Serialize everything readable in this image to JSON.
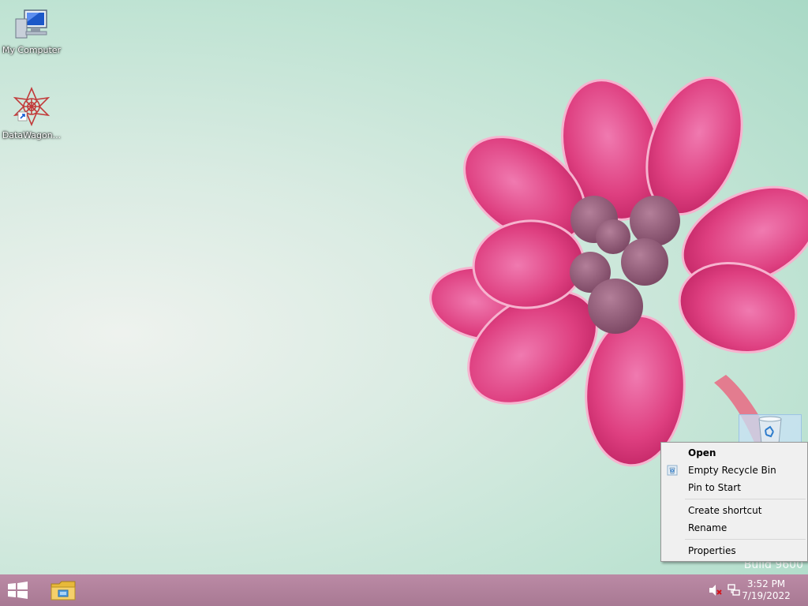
{
  "desktop": {
    "icons": [
      {
        "label": "My Computer",
        "icon": "computer-icon"
      },
      {
        "label": "DataWagon...",
        "icon": "datawagon-shortcut-icon"
      }
    ],
    "recycle_bin_icon": "recycle-bin-icon",
    "watermark": "Build 9600"
  },
  "context_menu": {
    "items": [
      {
        "label": "Open",
        "bold": true
      },
      {
        "label": "Empty Recycle Bin",
        "icon": "recycle-bin-small-icon"
      },
      {
        "label": "Pin to Start"
      },
      {
        "label": "Create shortcut"
      },
      {
        "label": "Rename"
      },
      {
        "label": "Properties"
      }
    ]
  },
  "taskbar": {
    "start_icon": "windows-start-icon",
    "pinned": [
      {
        "icon": "file-explorer-icon"
      }
    ],
    "tray": {
      "icons": [
        "volume-muted-icon",
        "network-icon"
      ],
      "time": "3:52 PM",
      "date": "7/19/2022"
    }
  },
  "colors": {
    "taskbar": "#b4849e",
    "flower": "#e0407f",
    "menu_bg": "#f0f0f0"
  }
}
